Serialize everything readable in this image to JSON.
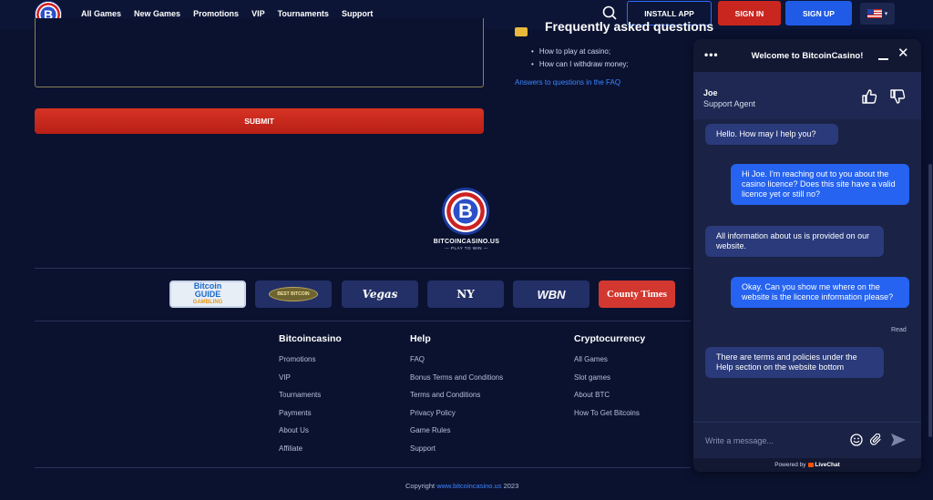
{
  "header": {
    "logo_letter": "B",
    "nav": [
      "All Games",
      "New Games",
      "Promotions",
      "VIP",
      "Tournaments",
      "Support"
    ],
    "active_nav": "Support",
    "install_label": "INSTALL APP",
    "signin_label": "SIGN IN",
    "signup_label": "SIGN UP",
    "lang_chevron": "▾"
  },
  "form": {
    "submit_label": "SUBMIT"
  },
  "faq": {
    "title": "Frequently asked questions",
    "items": [
      "How to play at casino;",
      "How can I withdraw money;"
    ],
    "link": "Answers to questions in the FAQ"
  },
  "brand": {
    "letter": "B",
    "name": "BITCOINCASINO.US",
    "tagline": "— PLAY TO WIN —"
  },
  "partners": {
    "p1_top": "Bitcoin",
    "p1_mid": "GUIDE",
    "p1_small": "GAMBLING",
    "p2": "BEST BITCOIN",
    "p3": "Vegas",
    "p4": "NY",
    "p5": "WBN",
    "p6": "County Times"
  },
  "footer": {
    "columns": [
      {
        "title": "Bitcoincasino",
        "links": [
          "Promotions",
          "VIP",
          "Tournaments",
          "Payments",
          "About Us",
          "Affiliate"
        ]
      },
      {
        "title": "Help",
        "links": [
          "FAQ",
          "Bonus Terms and Conditions",
          "Terms and Conditions",
          "Privacy Policy",
          "Game Rules",
          "Support"
        ]
      },
      {
        "title": "Cryptocurrency",
        "links": [
          "All Games",
          "Slot games",
          "About BTC",
          "How To Get Bitcoins"
        ]
      }
    ],
    "copyright_prefix": "Copyright ",
    "copyright_link": "www.bitcoincasino.us",
    "copyright_year": " 2023"
  },
  "chat": {
    "menu": "•••",
    "title": "Welcome to BitcoinCasino!",
    "close": "✕",
    "agent_name": "Joe",
    "agent_role": "Support Agent",
    "messages": [
      {
        "from": "agent",
        "text": "Hello. How may I help you?"
      },
      {
        "from": "user",
        "text": "Hi Joe. I'm reaching out to you about the casino licence? Does this site have a valid licence yet or still no?"
      },
      {
        "from": "agent",
        "text": "All information about us is provided on our website."
      },
      {
        "from": "user",
        "text": "Okay. Can you show me where on the website is the licence information please?"
      },
      {
        "from": "agent",
        "text": "There are terms and policies under the Help section on the website bottom"
      }
    ],
    "read_label": "Read",
    "input_placeholder": "Write a message...",
    "powered_prefix": "Powered by",
    "powered_brand": "LiveChat"
  },
  "colors": {
    "background": "#0a1230",
    "accent_blue": "#2f6bff",
    "signin_red": "#c9261f",
    "user_bubble": "#2563f0",
    "agent_bubble": "#2a3a7a"
  }
}
